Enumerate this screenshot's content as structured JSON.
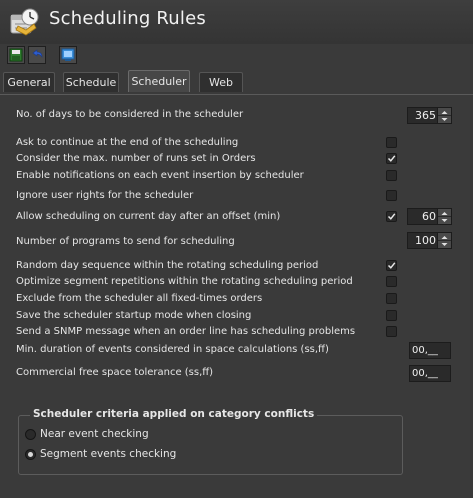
{
  "window": {
    "title": "Scheduling Rules",
    "accent_color": "#3b8fd9"
  },
  "toolbar": {
    "buttons": [
      {
        "name": "save-icon"
      },
      {
        "name": "undo-icon"
      },
      {
        "name": "display-icon"
      }
    ]
  },
  "tabs": [
    {
      "label": "General",
      "active": false
    },
    {
      "label": "Schedule",
      "active": false
    },
    {
      "label": "Scheduler",
      "active": true
    },
    {
      "label": "Web",
      "active": false
    }
  ],
  "settings": {
    "days_label": "No. of days to be considered in the scheduler",
    "days_value": "365",
    "ask_continue": {
      "label": "Ask to continue at the end of the scheduling",
      "checked": false
    },
    "consider_max_runs": {
      "label": "Consider the max. number of runs set in Orders",
      "checked": true
    },
    "enable_notifications": {
      "label": "Enable notifications on each event insertion by scheduler",
      "checked": false
    },
    "ignore_user_rights": {
      "label": "Ignore user rights for the scheduler",
      "checked": false
    },
    "allow_current_day": {
      "label": "Allow scheduling on current day after an offset (min)",
      "checked": true
    },
    "offset_value": "60",
    "programs_label": "Number of programs to send for scheduling",
    "programs_value": "100",
    "random_day": {
      "label": "Random day sequence within the rotating scheduling period",
      "checked": true
    },
    "optimize_repetitions": {
      "label": "Optimize segment repetitions within the rotating scheduling period",
      "checked": false
    },
    "exclude_fixed": {
      "label": "Exclude from the scheduler all fixed-times orders",
      "checked": false
    },
    "save_startup_mode": {
      "label": "Save the scheduler startup mode when closing",
      "checked": false
    },
    "send_snmp": {
      "label": "Send a SNMP message when an order line has scheduling problems",
      "checked": false
    },
    "min_duration_label": "Min. duration of events considered in space calculations (ss,ff)",
    "min_duration_value": "00,__",
    "commercial_free_label": "Commercial free space tolerance (ss,ff)",
    "commercial_free_value": "00,__"
  },
  "criteria": {
    "title": "Scheduler criteria applied on category conflicts",
    "options": [
      {
        "label": "Near event checking",
        "selected": false
      },
      {
        "label": "Segment events checking",
        "selected": true
      }
    ]
  }
}
